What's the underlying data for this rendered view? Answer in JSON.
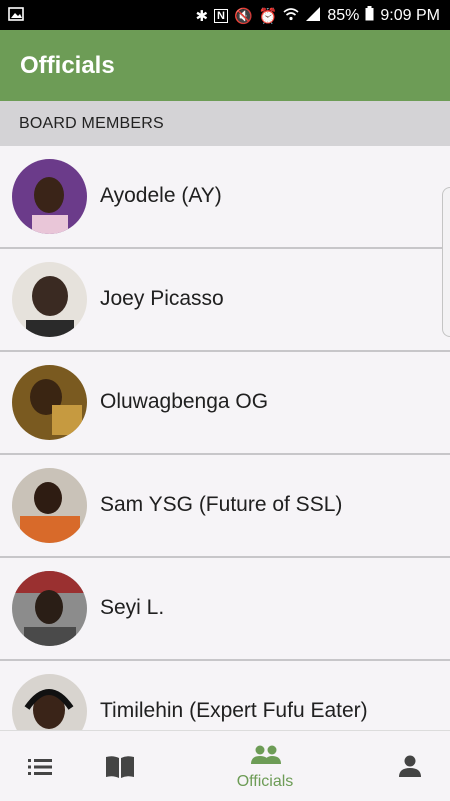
{
  "status_bar": {
    "battery": "85%",
    "time": "9:09 PM"
  },
  "app_bar": {
    "title": "Officials"
  },
  "section": {
    "header": "BOARD MEMBERS"
  },
  "members": [
    {
      "name": "Ayodele (AY)",
      "avatar_color": "#6b3b8a"
    },
    {
      "name": "Joey Picasso",
      "avatar_color": "#e6e2dc"
    },
    {
      "name": "Oluwagbenga OG",
      "avatar_color": "#7a5a20"
    },
    {
      "name": "Sam YSG (Future of SSL)",
      "avatar_color": "#d86a2a"
    },
    {
      "name": "Seyi L.",
      "avatar_color": "#9a3030"
    },
    {
      "name": "Timilehin (Expert Fufu Eater)",
      "avatar_color": "#d8d4cf"
    }
  ],
  "bottom_nav": {
    "items": [
      {
        "icon": "list-icon",
        "label": ""
      },
      {
        "icon": "book-icon",
        "label": ""
      },
      {
        "icon": "people-icon",
        "label": "Officials",
        "active": true
      },
      {
        "icon": "person-icon",
        "label": ""
      }
    ]
  },
  "colors": {
    "accent": "#6d9c56",
    "inactive_icon": "#444444"
  }
}
